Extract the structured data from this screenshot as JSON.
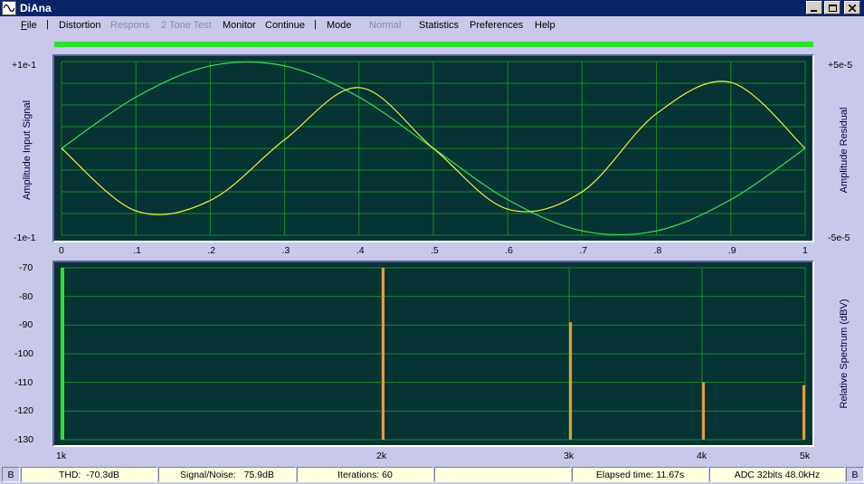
{
  "window": {
    "title": "DiAna"
  },
  "titlebar_buttons": {
    "minimize": "▁",
    "maximize": "□",
    "close": "✕"
  },
  "menu": {
    "file": "File",
    "distortion": "Distortion",
    "respons": "Respons",
    "two_tone": "2 Tone Test",
    "monitor": "Monitor",
    "continue": "Continue",
    "mode": "Mode",
    "normal": "Normal",
    "statistics": "Statistics",
    "preferences": "Preferences",
    "help": "Help",
    "separator": "|"
  },
  "progress": {
    "fraction": 1.0,
    "color": "#2ee02e"
  },
  "time_panel": {
    "left_label": "Amplitude Input Signal",
    "right_label": "Amplitude Residual",
    "left_top": "+1e-1",
    "left_bottom": "-1e-1",
    "right_top": "+5e-5",
    "right_bottom": "-5e-5",
    "x_ticks": [
      "0",
      ".1",
      ".2",
      ".3",
      ".4",
      ".5",
      ".6",
      ".7",
      ".8",
      ".9",
      "1"
    ]
  },
  "spectrum_panel": {
    "right_label": "Relative Spectrum (dBV)",
    "y_ticks": [
      "-70",
      "-80",
      "-90",
      "-100",
      "-110",
      "-120",
      "-130"
    ],
    "x_ticks": [
      "1k",
      "2k",
      "3k",
      "4k",
      "5k"
    ]
  },
  "chart_data": [
    {
      "type": "line",
      "x": [
        0,
        0.1,
        0.2,
        0.3,
        0.4,
        0.5,
        0.6,
        0.7,
        0.8,
        0.9,
        1
      ],
      "xlim": [
        0,
        1
      ],
      "series": [
        {
          "color": "#3cdc5c",
          "description_axis": "left",
          "values": [
            0.0,
            0.059,
            0.095,
            0.095,
            0.059,
            0.0,
            -0.059,
            -0.095,
            -0.095,
            -0.059,
            0.0
          ]
        },
        {
          "color": "#f0f040",
          "description_axis": "right",
          "values": [
            0.0,
            -3.6e-05,
            -3e-05,
            5e-06,
            3.5e-05,
            0.0,
            -3.5e-05,
            -2.5e-05,
            2e-05,
            3.8e-05,
            0.0
          ]
        }
      ],
      "ylim_left": [
        -0.1,
        0.1
      ],
      "ylim_right": [
        -5e-05,
        5e-05
      ],
      "grid": true
    },
    {
      "type": "bar",
      "categories": [
        "1k",
        "2k",
        "3k",
        "4k",
        "5k"
      ],
      "x_hz": [
        1000,
        2000,
        3000,
        4000,
        5000
      ],
      "values": [
        0,
        -70,
        -89,
        -110,
        -111
      ],
      "colors": [
        "#2ee02e",
        "#e89a40",
        "#e89a40",
        "#e89a40",
        "#e89a40"
      ],
      "ylim": [
        -130,
        -70
      ],
      "xscale": "log",
      "grid": true
    }
  ],
  "status": {
    "left_b": "B",
    "thd": "THD:  -70.3dB",
    "snr": "Signal/Noise:   75.9dB",
    "iterations": "Iterations: 60",
    "empty": "",
    "elapsed": "Elapsed time: 11.67s",
    "adc": "ADC 32bits 48.0kHz",
    "right_b": "B"
  }
}
